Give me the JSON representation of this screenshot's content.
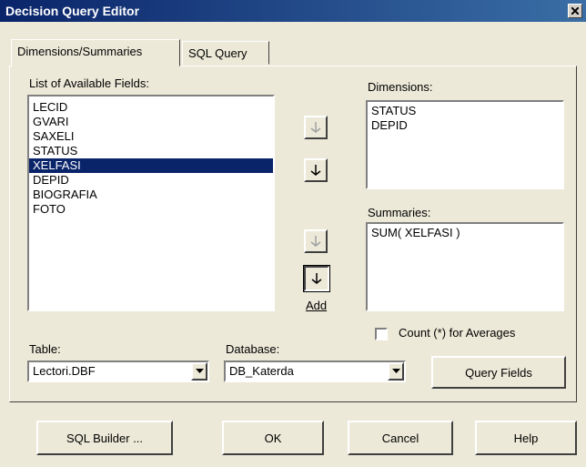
{
  "window": {
    "title": "Decision Query Editor"
  },
  "tabs": [
    {
      "label": "Dimensions/Summaries",
      "active": true
    },
    {
      "label": "SQL Query",
      "active": false
    }
  ],
  "available_fields": {
    "label": "List of Available Fields:",
    "items": [
      "LECID",
      "GVARI",
      "SAXELI",
      "STATUS",
      "XELFASI",
      "DEPID",
      "BIOGRAFIA",
      "FOTO"
    ],
    "selected": "XELFASI"
  },
  "dimensions": {
    "label": "Dimensions:",
    "items": [
      "STATUS",
      "DEPID"
    ]
  },
  "summaries": {
    "label": "Summaries:",
    "items": [
      "SUM( XELFASI )"
    ]
  },
  "add_label": "Add",
  "count_checkbox": {
    "label": "Count (*) for Averages",
    "checked": false
  },
  "table": {
    "label": "Table:",
    "value": "Lectori.DBF"
  },
  "database": {
    "label": "Database:",
    "value": "DB_Katerda"
  },
  "buttons": {
    "query_fields": "Query Fields",
    "sql_builder": "SQL Builder ...",
    "ok": "OK",
    "cancel": "Cancel",
    "help": "Help"
  },
  "icons": {
    "close": "close-icon",
    "arrow": "arrow-down-icon",
    "dropdown": "chevron-down-icon"
  }
}
